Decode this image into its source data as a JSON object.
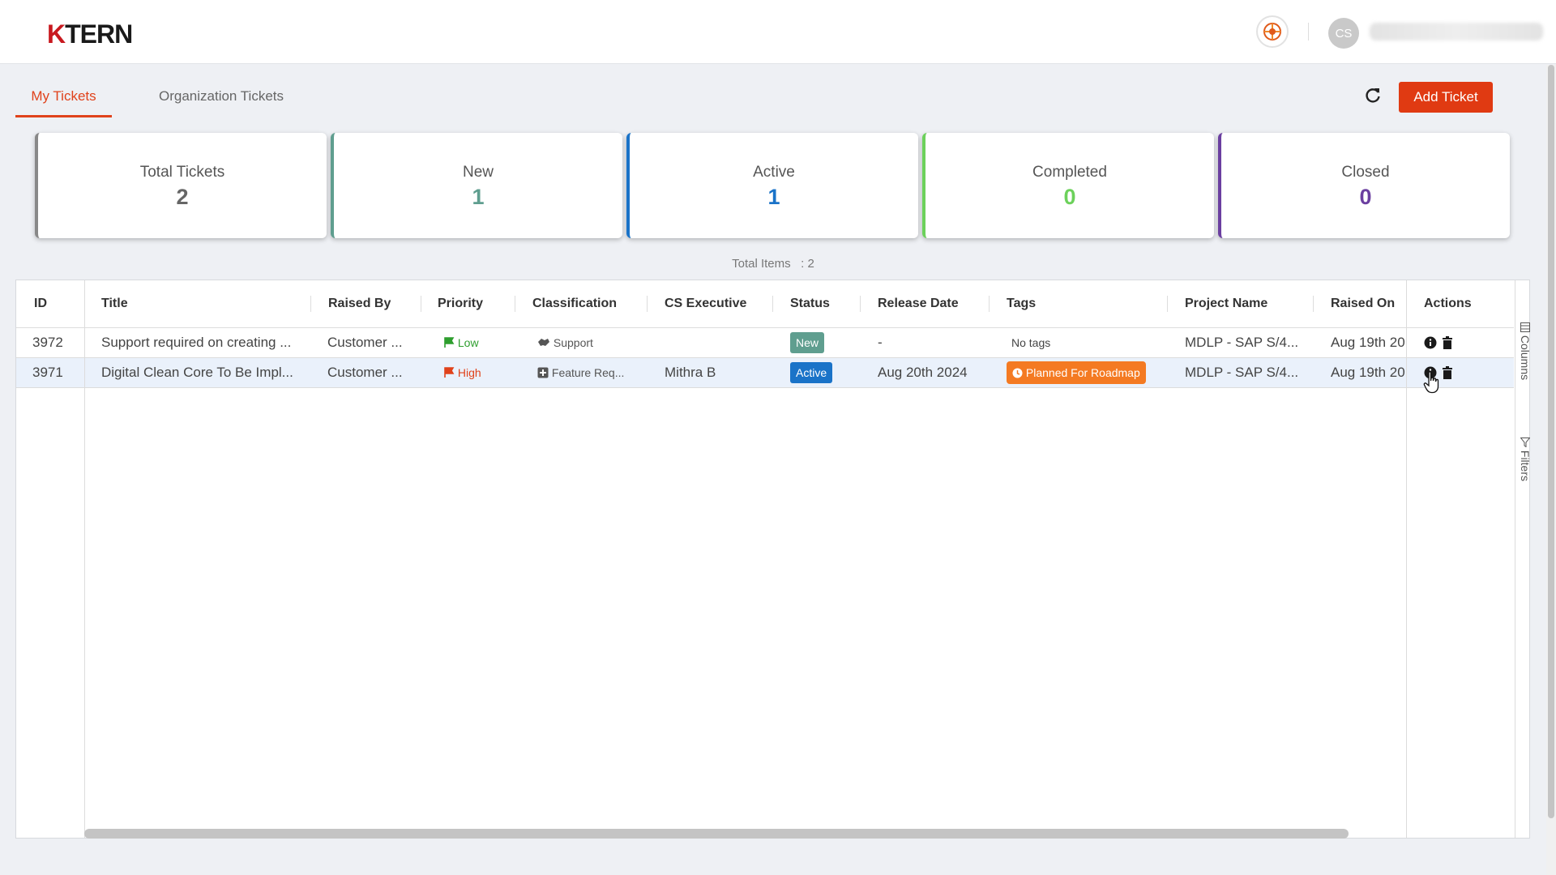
{
  "app": {
    "logo_text": "KTERN",
    "logo_accent": "K",
    "logo_rest": "TERN",
    "user_initials": "CS",
    "accent_color": "#e03a12"
  },
  "tabs": [
    {
      "label": "My Tickets",
      "active": true
    },
    {
      "label": "Organization Tickets",
      "active": false
    }
  ],
  "toolbar": {
    "add_label": "Add Ticket"
  },
  "summary": [
    {
      "label": "Total Tickets",
      "value": "2",
      "color": "#666666"
    },
    {
      "label": "New",
      "value": "1",
      "color": "#5f9e8f"
    },
    {
      "label": "Active",
      "value": "1",
      "color": "#1a73c8"
    },
    {
      "label": "Completed",
      "value": "0",
      "color": "#6cd15b"
    },
    {
      "label": "Closed",
      "value": "0",
      "color": "#6b3fa0"
    }
  ],
  "total_items": {
    "label": "Total Items",
    "sep": ":",
    "value": "2"
  },
  "table": {
    "columns": [
      "ID",
      "Title",
      "Raised By",
      "Priority",
      "Classification",
      "CS Executive",
      "Status",
      "Release Date",
      "Tags",
      "Project Name",
      "Raised On",
      "Actions"
    ],
    "rows": [
      {
        "id": "3972",
        "title": "Support required on creating ...",
        "raised_by": "Customer ...",
        "priority": "Low",
        "priority_color": "#2e9e2e",
        "classification": "Support",
        "classification_icon": "handshake-icon",
        "cs_executive": "",
        "status": "New",
        "status_color": "#5f9e8f",
        "release_date": "-",
        "tags": "No tags",
        "project": "MDLP - SAP S/4...",
        "raised_on": "Aug 19th 20"
      },
      {
        "id": "3971",
        "title": "Digital Clean Core To Be Impl...",
        "raised_by": "Customer ...",
        "priority": "High",
        "priority_color": "#e0421b",
        "classification": "Feature Req...",
        "classification_icon": "plus-square-icon",
        "cs_executive": "Mithra B",
        "status": "Active",
        "status_color": "#1a73c8",
        "release_date": "Aug 20th 2024",
        "tags": "Planned For Roadmap",
        "project": "MDLP - SAP S/4...",
        "raised_on": "Aug 19th 20"
      }
    ]
  },
  "side": {
    "columns_label": "Columns",
    "filters_label": "Filters"
  }
}
